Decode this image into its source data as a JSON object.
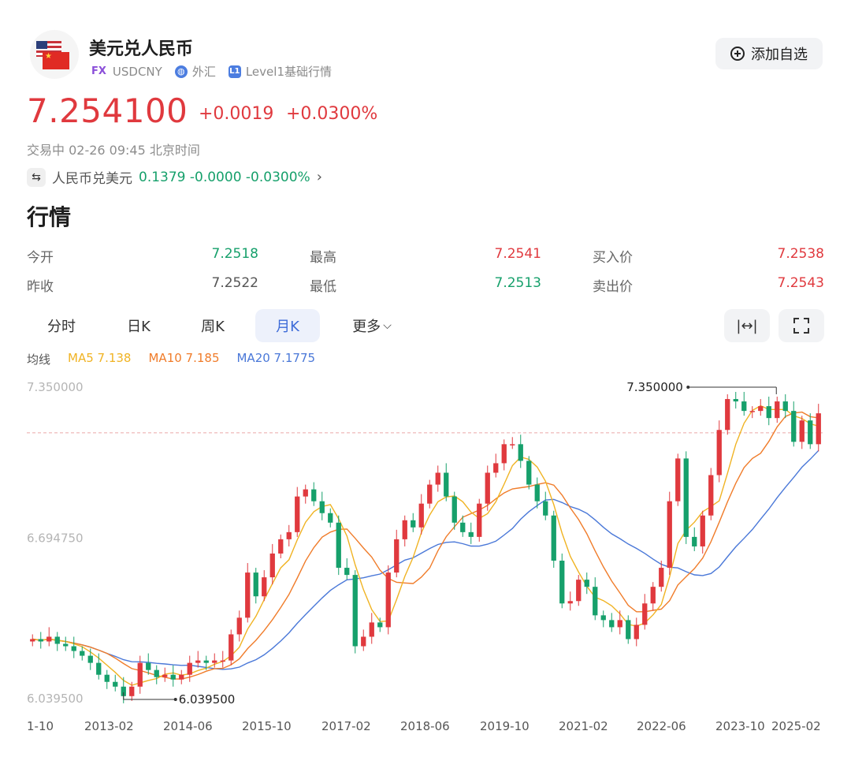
{
  "header": {
    "title": "美元兑人民币",
    "market_tag": "FX",
    "symbol": "USDCNY",
    "market": "外汇",
    "level_badge": "L1",
    "level": "Level1基础行情",
    "watch_button": "添加自选"
  },
  "quote": {
    "price": "7.254100",
    "change": "+0.0019",
    "change_pct": "+0.0300%",
    "status": "交易中 02-26 09:45 北京时间"
  },
  "inverse": {
    "label": "人民币兑美元",
    "value": "0.1379 -0.0000 -0.0300%"
  },
  "section_title": "行情",
  "stats": [
    {
      "label": "今开",
      "value": "7.2518",
      "color": "#16a06b"
    },
    {
      "label": "最高",
      "value": "7.2541",
      "color": "#e0393e"
    },
    {
      "label": "买入价",
      "value": "7.2538",
      "color": "#e0393e"
    },
    {
      "label": "昨收",
      "value": "7.2522",
      "color": "#555555"
    },
    {
      "label": "最低",
      "value": "7.2513",
      "color": "#16a06b"
    },
    {
      "label": "卖出价",
      "value": "7.2543",
      "color": "#e0393e"
    }
  ],
  "tabs": [
    {
      "label": "分时",
      "active": false
    },
    {
      "label": "日K",
      "active": false
    },
    {
      "label": "周K",
      "active": false
    },
    {
      "label": "月K",
      "active": true
    },
    {
      "label": "更多",
      "active": false
    }
  ],
  "tools": {
    "fit_icon": "expand-horizontal-icon",
    "fullscreen_icon": "fullscreen-icon"
  },
  "ma": {
    "label": "均线",
    "ma5": "MA5 7.138",
    "ma10": "MA10 7.185",
    "ma20": "MA20 7.1775"
  },
  "colors": {
    "up": "#e0393e",
    "down": "#16a06b",
    "ma5": "#f0b323",
    "ma10": "#f07c2a",
    "ma20": "#4a78d8",
    "accent": "#3d6bd8"
  },
  "chart_data": {
    "type": "candlestick",
    "ylim": [
      6.0395,
      7.35
    ],
    "y_ticks": [
      "7.350000",
      "6.694750",
      "6.039500"
    ],
    "x_ticks": [
      "1-10",
      "2013-02",
      "2014-06",
      "2015-10",
      "2017-02",
      "2018-06",
      "2019-10",
      "2021-02",
      "2022-06",
      "2023-10",
      "2025-02"
    ],
    "max_label": "7.350000",
    "min_label": "6.039500",
    "current_price": 7.2541,
    "monthly_close": [
      6.3,
      6.29,
      6.31,
      6.28,
      6.27,
      6.25,
      6.23,
      6.2,
      6.15,
      6.12,
      6.1,
      6.06,
      6.1,
      6.2,
      6.17,
      6.14,
      6.15,
      6.13,
      6.15,
      6.2,
      6.21,
      6.2,
      6.21,
      6.21,
      6.32,
      6.39,
      6.58,
      6.48,
      6.56,
      6.66,
      6.72,
      6.75,
      6.9,
      6.93,
      6.88,
      6.83,
      6.79,
      6.6,
      6.57,
      6.27,
      6.31,
      6.37,
      6.35,
      6.58,
      6.72,
      6.8,
      6.77,
      6.87,
      6.95,
      7.0,
      6.9,
      6.79,
      6.75,
      6.73,
      6.87,
      7.0,
      7.04,
      7.12,
      7.12,
      7.05,
      6.95,
      6.88,
      6.82,
      6.63,
      6.45,
      6.46,
      6.55,
      6.52,
      6.4,
      6.38,
      6.35,
      6.38,
      6.3,
      6.36,
      6.45,
      6.52,
      6.6,
      6.88,
      7.06,
      6.73,
      6.69,
      6.82,
      6.99,
      7.18,
      7.31,
      7.3,
      7.26,
      7.26,
      7.28,
      7.23,
      7.3,
      7.26,
      7.13,
      7.22,
      7.12,
      7.25
    ]
  }
}
